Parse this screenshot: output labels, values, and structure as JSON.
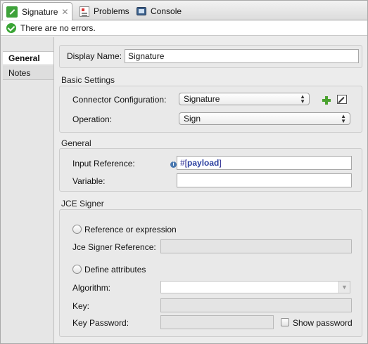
{
  "tabs": [
    {
      "label": "Signature",
      "active": true,
      "icon": "signature-icon"
    },
    {
      "label": "Problems",
      "active": false,
      "icon": "problems-icon"
    },
    {
      "label": "Console",
      "active": false,
      "icon": "console-icon"
    }
  ],
  "status": {
    "text": "There are no errors.",
    "icon": "check-circle-icon"
  },
  "nav": {
    "items": [
      {
        "label": "General",
        "active": true
      },
      {
        "label": "Notes",
        "active": false
      }
    ]
  },
  "display_name": {
    "label": "Display Name:",
    "value": "Signature"
  },
  "basic_settings": {
    "title": "Basic Settings",
    "connector_label": "Connector Configuration:",
    "connector_value": "Signature",
    "operation_label": "Operation:",
    "operation_value": "Sign"
  },
  "general": {
    "title": "General",
    "input_ref_label": "Input Reference:",
    "input_ref_prefix": "#[",
    "input_ref_keyword": "payload",
    "input_ref_suffix": "]",
    "variable_label": "Variable:",
    "variable_value": ""
  },
  "jce": {
    "title": "JCE Signer",
    "ref_radio_label": "Reference or expression",
    "signer_ref_label": "Jce Signer Reference:",
    "define_radio_label": "Define attributes",
    "algorithm_label": "Algorithm:",
    "key_label": "Key:",
    "key_password_label": "Key Password:",
    "show_password_label": "Show password"
  },
  "colors": {
    "accent_green": "#3ea23a",
    "info_blue": "#4a79b0"
  }
}
